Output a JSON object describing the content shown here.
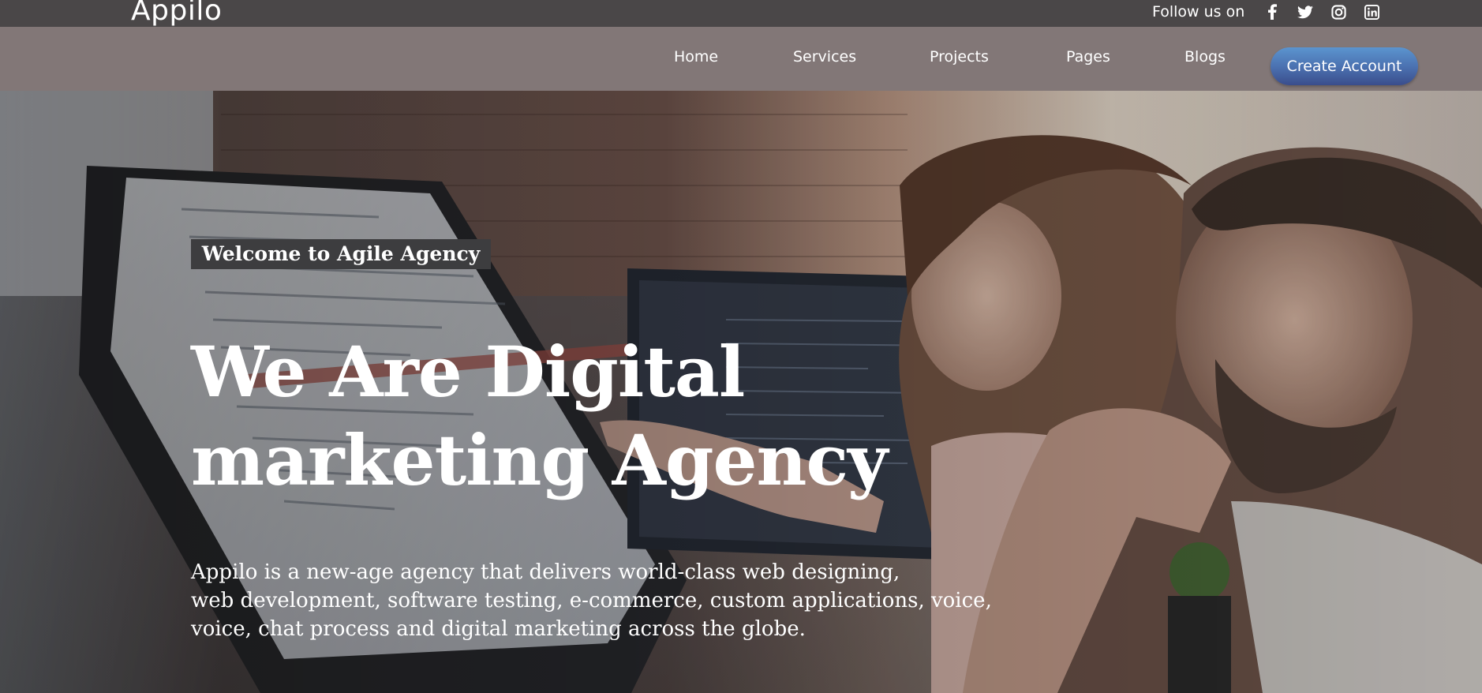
{
  "brand": {
    "name": "Appilo"
  },
  "social": {
    "label": "Follow us on",
    "icons": [
      "facebook-icon",
      "twitter-icon",
      "instagram-icon",
      "linkedin-icon"
    ]
  },
  "nav": {
    "items": [
      {
        "label": "Home"
      },
      {
        "label": "Services"
      },
      {
        "label": "Projects"
      },
      {
        "label": "Pages"
      },
      {
        "label": "Blogs"
      }
    ],
    "cta_label": "Create Account"
  },
  "hero": {
    "badge": "Welcome to Agile Agency",
    "headline": [
      "We Are Digital",
      "marketing Agency"
    ],
    "description": [
      "Appilo is a new-age agency that delivers world-class web designing,",
      "web development, software testing, e-commerce, custom applications, voice,",
      "voice, chat process and digital marketing across the globe."
    ]
  },
  "colors": {
    "topbar": "#4a4748",
    "navbar": "#827777",
    "cta_gradient_top": "#5b94cf",
    "cta_gradient_bottom": "#3a4d8c",
    "badge_bg": "#3d3d3f",
    "text": "#ffffff"
  }
}
